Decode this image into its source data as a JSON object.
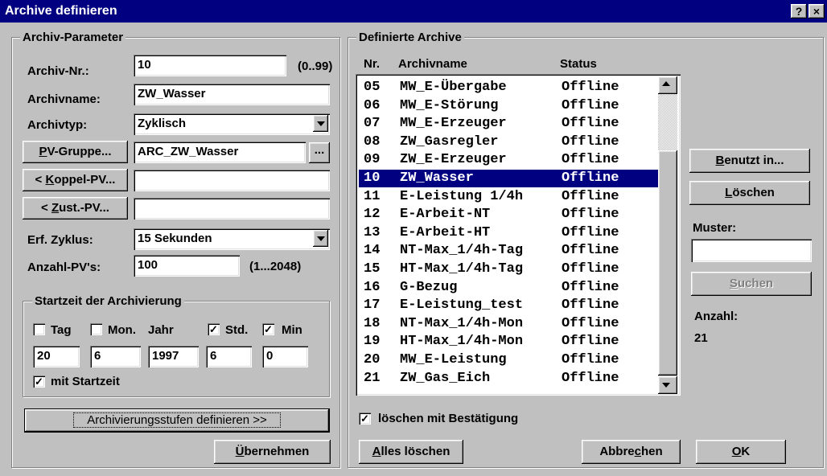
{
  "window": {
    "title": "Archive definieren",
    "help_label": "?",
    "close_label": "×"
  },
  "params": {
    "group_title": "Archiv-Parameter",
    "archiv_nr_label": "Archiv-Nr.:",
    "archiv_nr_value": "10",
    "archiv_nr_range": "(0..99)",
    "archivname_label": "Archivname:",
    "archivname_value": "ZW_Wasser",
    "archivtyp_label": "Archivtyp:",
    "archivtyp_value": "Zyklisch",
    "pv_gruppe_button_pre": "",
    "pv_gruppe_button_u": "P",
    "pv_gruppe_button_post": "V-Gruppe...",
    "pv_gruppe_value": "ARC_ZW_Wasser",
    "browse_label": "...",
    "koppel_button_pre": "< ",
    "koppel_button_u": "K",
    "koppel_button_post": "oppel-PV...",
    "koppel_value": "",
    "zust_button_pre": "< ",
    "zust_button_u": "Z",
    "zust_button_post": "ust.-PV...",
    "zust_value": "",
    "erf_zyklus_label": "Erf. Zyklus:",
    "erf_zyklus_value": "15 Sekunden",
    "anzahl_pv_label": "Anzahl-PV's:",
    "anzahl_pv_value": "100",
    "anzahl_pv_range": "(1...2048)"
  },
  "startzeit": {
    "group_title": "Startzeit der Archivierung",
    "tag_label": "Tag",
    "tag_checked": false,
    "mon_label": "Mon.",
    "mon_checked": false,
    "jahr_label": "Jahr",
    "std_label": "Std.",
    "std_checked": true,
    "min_label": "Min",
    "min_checked": true,
    "tag_value": "20",
    "mon_value": "6",
    "jahr_value": "1997",
    "std_value": "6",
    "min_value": "0",
    "mit_startzeit_label": "mit Startzeit",
    "mit_startzeit_checked": true,
    "check_glyph": "✓"
  },
  "buttons": {
    "archivierungsstufen": "Archivierungsstufen definieren >>",
    "uebernehmen_u": "Ü",
    "uebernehmen_post": "bernehmen",
    "benutzt_u": "B",
    "benutzt_post": "enutzt in...",
    "loeschen_u": "L",
    "loeschen_post": "öschen",
    "suchen_u": "S",
    "suchen_post": "uchen",
    "alles_u": "A",
    "alles_post": "lles löschen",
    "abbrechen_pre": "Abbre",
    "abbrechen_u": "c",
    "abbrechen_post": "hen",
    "ok_u": "O",
    "ok_post": "K"
  },
  "archive": {
    "group_title": "Definierte Archive",
    "columns": {
      "nr": "Nr.",
      "name": "Archivname",
      "status": "Status"
    },
    "rows": [
      {
        "nr": "05",
        "name": "MW_E-Übergabe",
        "status": "Offline"
      },
      {
        "nr": "06",
        "name": "MW_E-Störung",
        "status": "Offline"
      },
      {
        "nr": "07",
        "name": "MW_E-Erzeuger",
        "status": "Offline"
      },
      {
        "nr": "08",
        "name": "ZW_Gasregler",
        "status": "Offline"
      },
      {
        "nr": "09",
        "name": "ZW_E-Erzeuger",
        "status": "Offline"
      },
      {
        "nr": "10",
        "name": "ZW_Wasser",
        "status": "Offline"
      },
      {
        "nr": "11",
        "name": "E-Leistung 1/4h",
        "status": "Offline"
      },
      {
        "nr": "12",
        "name": "E-Arbeit-NT",
        "status": "Offline"
      },
      {
        "nr": "13",
        "name": "E-Arbeit-HT",
        "status": "Offline"
      },
      {
        "nr": "14",
        "name": "NT-Max_1/4h-Tag",
        "status": "Offline"
      },
      {
        "nr": "15",
        "name": "HT-Max_1/4h-Tag",
        "status": "Offline"
      },
      {
        "nr": "16",
        "name": "G-Bezug",
        "status": "Offline"
      },
      {
        "nr": "17",
        "name": "E-Leistung_test",
        "status": "Offline"
      },
      {
        "nr": "18",
        "name": "NT-Max_1/4h-Mon",
        "status": "Offline"
      },
      {
        "nr": "19",
        "name": "HT-Max_1/4h-Mon",
        "status": "Offline"
      },
      {
        "nr": "20",
        "name": "MW_E-Leistung",
        "status": "Offline"
      },
      {
        "nr": "21",
        "name": "ZW_Gas_Eich",
        "status": "Offline"
      }
    ],
    "selected_nr": "10",
    "loeschen_bestaetigung_label": "löschen mit Bestätigung",
    "loeschen_bestaetigung_checked": true
  },
  "side": {
    "muster_label": "Muster:",
    "muster_value": "",
    "anzahl_label": "Anzahl:",
    "anzahl_value": "21"
  },
  "colors": {
    "face": "#c0c0c0",
    "title": "#000080",
    "selection": "#000080"
  }
}
